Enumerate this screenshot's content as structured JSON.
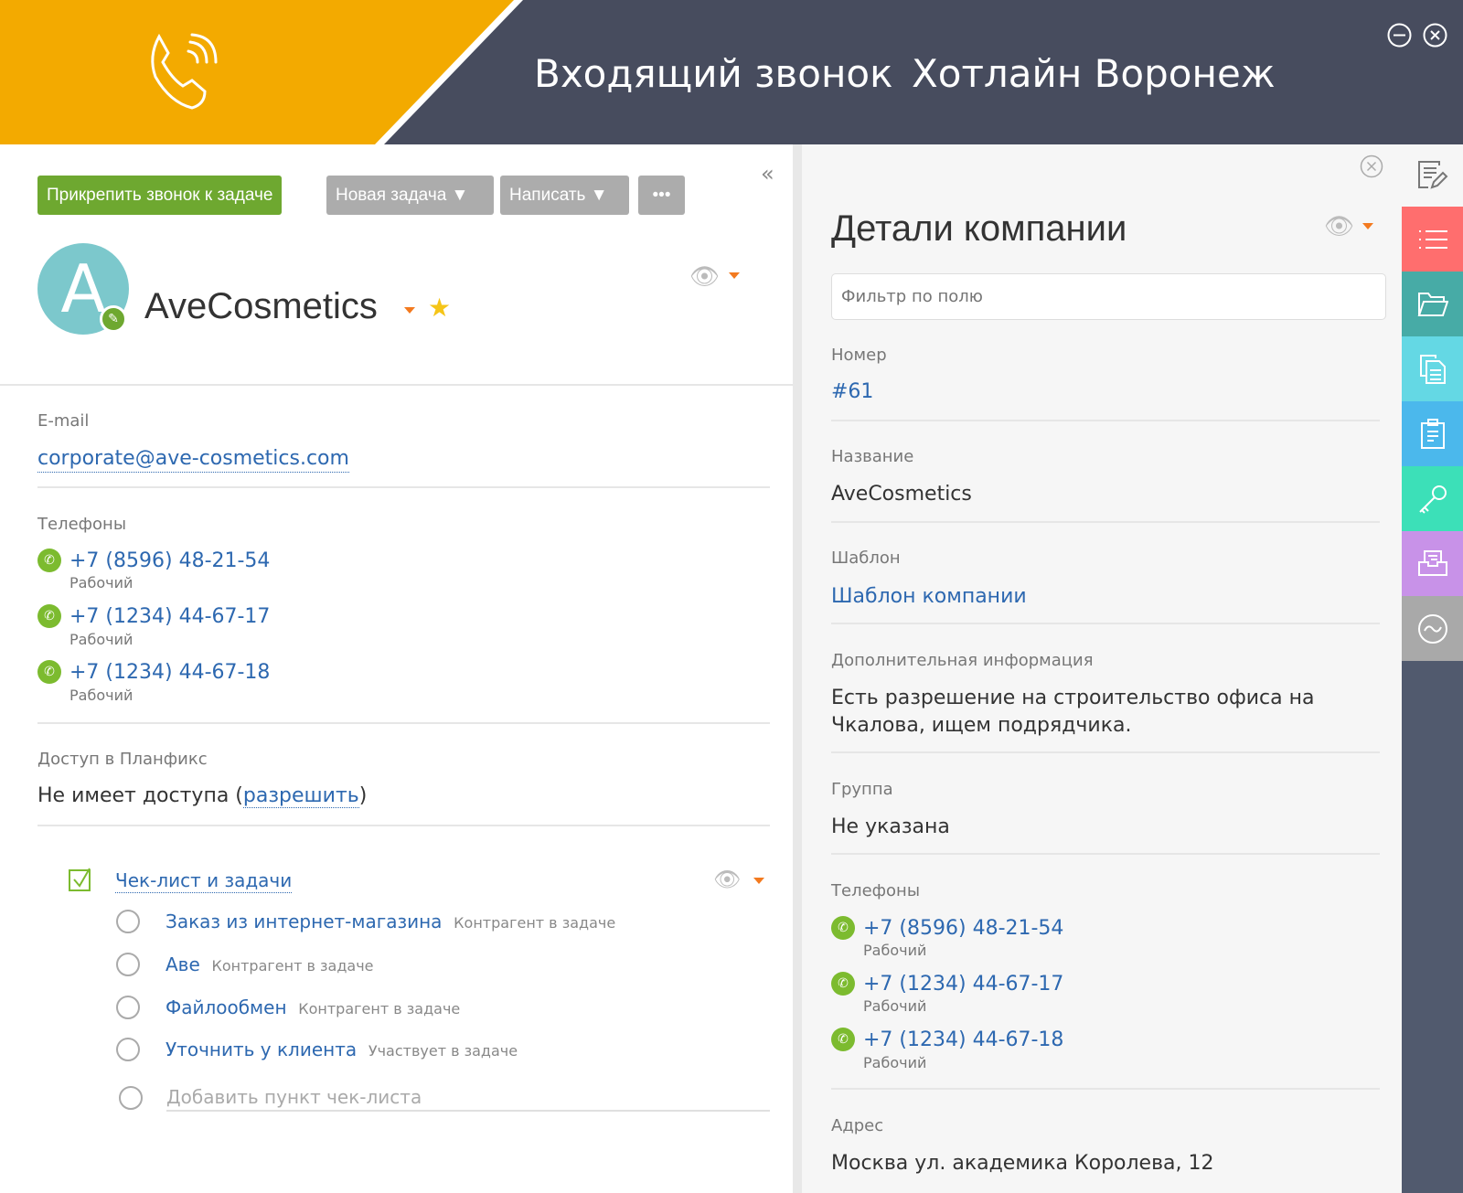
{
  "header": {
    "title": "Входящий звонок",
    "line": "Хотлайн Воронеж",
    "colors": {
      "accent": "#f3aa00",
      "dark": "#474c5e"
    }
  },
  "toolbar": {
    "attach": "Прикрепить звонок к задаче",
    "new_task": "Новая задача ▼",
    "write": "Написать ▼",
    "more": "•••",
    "collapse": "«"
  },
  "contact": {
    "avatar_letter": "A",
    "name": "AveCosmetics",
    "email_label": "E-mail",
    "email": "corporate@ave-cosmetics.com",
    "phones_label": "Телефоны",
    "phones": [
      {
        "number": "+7 (8596) 48-21-54",
        "type": "Рабочий"
      },
      {
        "number": "+7 (1234) 44-67-17",
        "type": "Рабочий"
      },
      {
        "number": "+7 (1234) 44-67-18",
        "type": "Рабочий"
      }
    ],
    "access_label": "Доступ в Планфикс",
    "access_text": "Не имеет доступа (",
    "access_link": "разрешить",
    "access_close": ")"
  },
  "checklist": {
    "title": "Чек-лист и задачи",
    "items": [
      {
        "name": "Заказ из интернет-магазина",
        "role": "Контрагент в задаче"
      },
      {
        "name": "Аве",
        "role": "Контрагент в задаче"
      },
      {
        "name": "Файлообмен",
        "role": "Контрагент в задаче"
      },
      {
        "name": "Уточнить у клиента",
        "role": "Участвует в задаче"
      }
    ],
    "add_placeholder": "Добавить пункт чек-листа"
  },
  "details": {
    "title": "Детали компании",
    "filter_placeholder": "Фильтр по полю",
    "number_label": "Номер",
    "number": "#61",
    "name_label": "Название",
    "name": "AveCosmetics",
    "template_label": "Шаблон",
    "template": "Шаблон компании",
    "info_label": "Дополнительная информация",
    "info_1": "Есть разрешение на строительство офиса на",
    "info_2": "Чкалова, ищем подрядчика.",
    "group_label": "Группа",
    "group": "Не указана",
    "phones_label": "Телефоны",
    "phones": [
      {
        "number": "+7 (8596) 48-21-54",
        "type": "Рабочий"
      },
      {
        "number": "+7 (1234) 44-67-17",
        "type": "Рабочий"
      },
      {
        "number": "+7 (1234) 44-67-18",
        "type": "Рабочий"
      }
    ],
    "address_label": "Адрес",
    "address": "Москва ул. академика Королева, 12"
  },
  "sidebar": [
    {
      "icon": "list-icon",
      "color": "#ff6e6e"
    },
    {
      "icon": "folder-icon",
      "color": "#47aba6"
    },
    {
      "icon": "documents-icon",
      "color": "#64d8e4"
    },
    {
      "icon": "clipboard-icon",
      "color": "#4bb8ec"
    },
    {
      "icon": "key-icon",
      "color": "#3ce0b8"
    },
    {
      "icon": "inbox-icon",
      "color": "#c892e8"
    },
    {
      "icon": "wave-icon",
      "color": "#a9a9a9"
    }
  ]
}
